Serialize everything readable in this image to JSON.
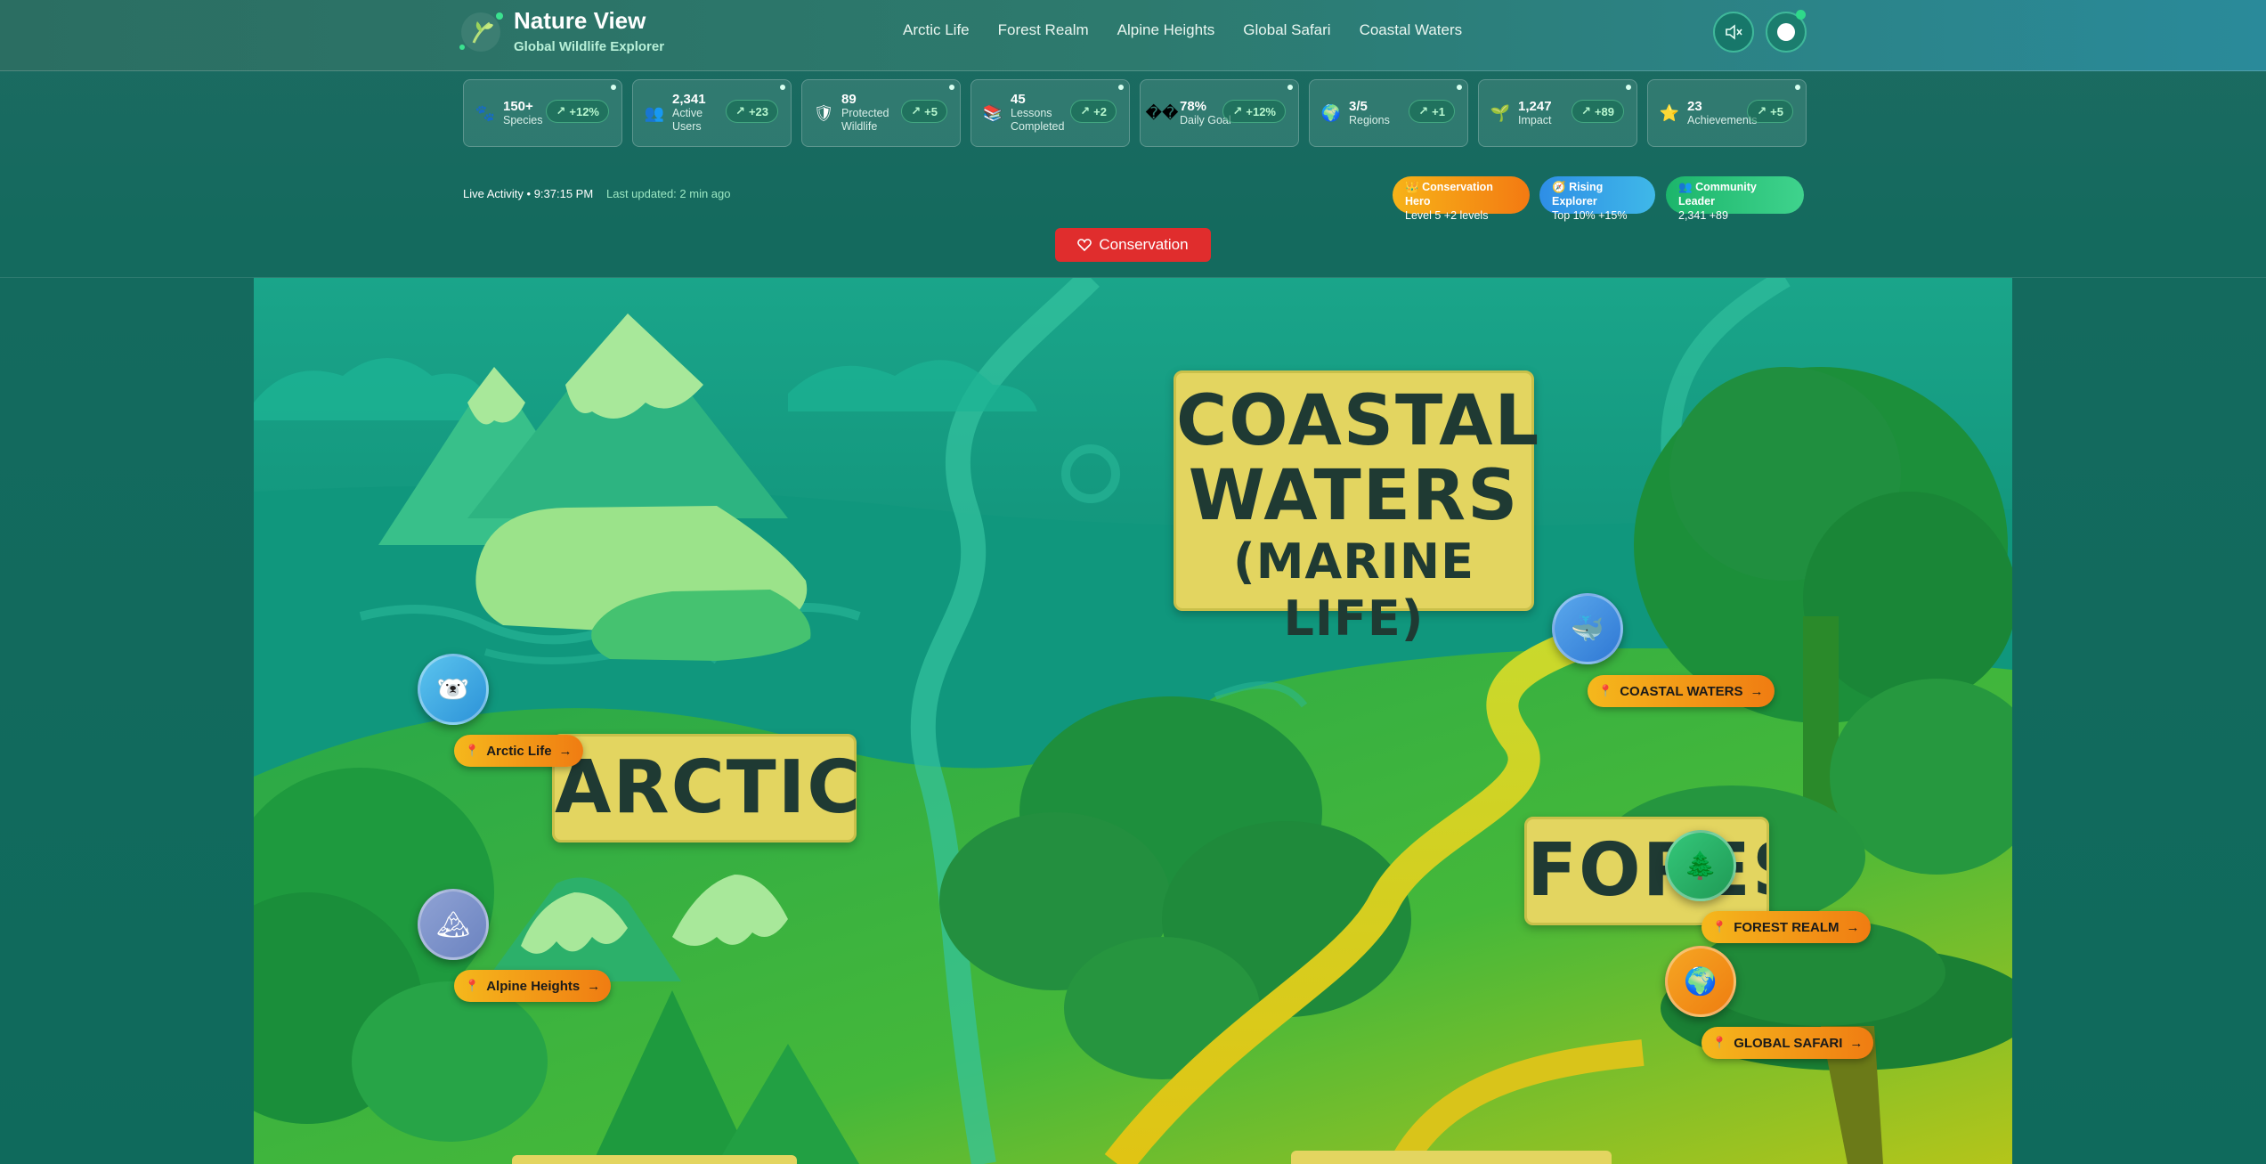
{
  "brand": {
    "title": "Nature View",
    "subtitle": "Global Wildlife Explorer"
  },
  "nav": [
    "Arctic Life",
    "Forest Realm",
    "Alpine Heights",
    "Global Safari",
    "Coastal Waters"
  ],
  "stats": [
    {
      "icon": "paw-icon",
      "glyph": "🐾",
      "value": "150+",
      "label": "Species",
      "delta": "+12%"
    },
    {
      "icon": "users-icon",
      "glyph": "👥",
      "value": "2,341",
      "label": "Active Users",
      "delta": "+23"
    },
    {
      "icon": "shield-icon",
      "glyph": "🛡",
      "value": "89",
      "label": "Protected Wildlife",
      "delta": "+5"
    },
    {
      "icon": "books-icon",
      "glyph": "📚",
      "value": "45",
      "label": "Lessons Completed",
      "delta": "+2"
    },
    {
      "icon": "broken-glyph-icon",
      "glyph": "��",
      "value": "78%",
      "label": "Daily Goal",
      "delta": "+12%"
    },
    {
      "icon": "globe-icon",
      "glyph": "🌍",
      "value": "3/5",
      "label": "Regions",
      "delta": "+1"
    },
    {
      "icon": "sprout-icon",
      "glyph": "🌱",
      "value": "1,247",
      "label": "Impact",
      "delta": "+89"
    },
    {
      "icon": "star-icon",
      "glyph": "⭐",
      "value": "23",
      "label": "Achievements",
      "delta": "+5"
    }
  ],
  "activity": {
    "live": "Live Activity • 9:37:15 PM",
    "updated": "Last updated: 2 min ago"
  },
  "badges": [
    {
      "title": "Conservation Hero",
      "detail": "Level 5 +2 levels",
      "glyph": "👑"
    },
    {
      "title": "Rising Explorer",
      "detail": "Top 10% +15%",
      "glyph": "🧭"
    },
    {
      "title": "Community Leader",
      "detail": "2,341 +89",
      "glyph": "👥"
    }
  ],
  "conservation_button": "Conservation",
  "map": {
    "signs": {
      "coastal_line1": "COASTAL",
      "coastal_line2": "WATERS",
      "coastal_line3": "(MARINE LIFE)",
      "arctic": "ARCTIC",
      "forest": "FORES"
    },
    "locations": [
      {
        "name": "Arctic Life",
        "icon": "polar-bear-icon",
        "glyph": "🐻‍❄️"
      },
      {
        "name": "Alpine Heights",
        "icon": "mountain-icon",
        "glyph": "🏔"
      },
      {
        "name": "COASTAL WATERS",
        "icon": "whale-icon",
        "glyph": "🐳"
      },
      {
        "name": "FOREST REALM",
        "icon": "tree-icon",
        "glyph": "🌲"
      },
      {
        "name": "GLOBAL SAFARI",
        "icon": "globe-icon",
        "glyph": "🌍"
      }
    ],
    "arrow": "→"
  },
  "colors": {
    "accent": "#f5b81c",
    "danger": "#e02d2d",
    "header": "#2d7a6e",
    "success": "#2fd98a"
  }
}
